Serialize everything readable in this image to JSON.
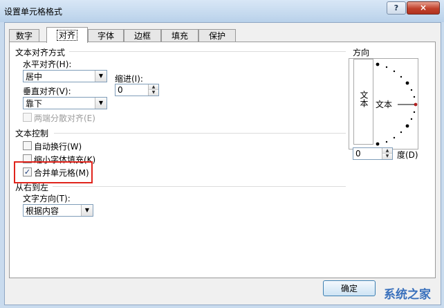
{
  "window": {
    "title": "设置单元格格式",
    "help_label": "?",
    "close_label": "×"
  },
  "tabs": [
    {
      "label": "数字"
    },
    {
      "label": "对齐"
    },
    {
      "label": "字体"
    },
    {
      "label": "边框"
    },
    {
      "label": "填充"
    },
    {
      "label": "保护"
    }
  ],
  "active_tab": "对齐",
  "alignment": {
    "group_label": "文本对齐方式",
    "horizontal_label": "水平对齐(H):",
    "horizontal_value": "居中",
    "indent_label": "缩进(I):",
    "indent_value": "0",
    "vertical_label": "垂直对齐(V):",
    "vertical_value": "靠下",
    "distributed_label": "两端分散对齐(E)"
  },
  "text_control": {
    "group_label": "文本控制",
    "wrap_label": "自动换行(W)",
    "wrap_checked": false,
    "shrink_label": "缩小字体填充(K)",
    "shrink_checked": false,
    "merge_label": "合并单元格(M)",
    "merge_checked": true,
    "merge_check_glyph": "✓"
  },
  "rtl": {
    "group_label": "从右到左",
    "direction_label": "文字方向(T):",
    "direction_value": "根据内容"
  },
  "orientation": {
    "group_label": "方向",
    "vertical_text": "文本",
    "dial_text": "文本",
    "degrees_value": "0",
    "degrees_label": "度(D)"
  },
  "footer": {
    "ok_label": "确定",
    "watermark": "系统之家"
  },
  "colors": {
    "highlight_border": "#e0231b",
    "dial_pointer": "#b22222"
  }
}
